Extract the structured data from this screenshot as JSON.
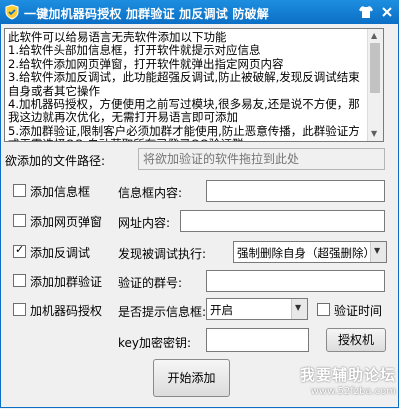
{
  "window": {
    "title": "一键加机器码授权 加群验证 加反调试 防破解"
  },
  "notice": {
    "text": "此软件可以给易语言无壳软件添加以下功能\n1.给软件头部加信息框，打开软件就提示对应信息\n2.给软件添加网页弹窗，打开软件就弹出指定网页内容\n3.给软件添加反调试，此功能超强反调试,防止被破解,发现反调试结束自身或者其它操作\n4.加机器码授权，方便使用之前写过模块,很多易友,还是说不方便，那我这边就再次优化，无需打开易语言即可添加\n5.添加群验证,限制客户必须加群才能使用,防止恶意传播，此群验证方式无需选择QQ,自动获取所有已登录QQ验证群"
  },
  "form": {
    "file_path_label": "欲添加的文件路径:",
    "file_path_placeholder": "将欲加验证的软件拖拉到此处",
    "info_box": {
      "checkbox_label": "添加信息框",
      "checked": false,
      "field_label": "信息框内容:",
      "value": ""
    },
    "web_popup": {
      "checkbox_label": "添加网页弹窗",
      "checked": false,
      "field_label": "网址内容:",
      "value": ""
    },
    "anti_debug": {
      "checkbox_label": "添加反调试",
      "checked": true,
      "field_label": "发现被调试执行:",
      "selected": "强制删除自身（超强删除）"
    },
    "group_verify": {
      "checkbox_label": "添加加群验证",
      "checked": false,
      "field_label": "验证的群号:",
      "value": ""
    },
    "machine_code": {
      "checkbox_label": "加机器码授权",
      "checked": false,
      "field_label": "是否提示信息框:",
      "selected": "开启",
      "verify_time_label": "验证时间",
      "verify_time_checked": false
    },
    "key": {
      "label": "key加密密钥:",
      "value": "",
      "auth_button": "授权机"
    },
    "start_button": "开始添加"
  },
  "watermark": {
    "line1": "我要辅助论坛",
    "line2": "www.52fzba.com"
  },
  "icons": {
    "app": "app-shield-icon",
    "skin": "shirt-icon",
    "close": "close-icon",
    "accent": "#0b6fc5"
  }
}
